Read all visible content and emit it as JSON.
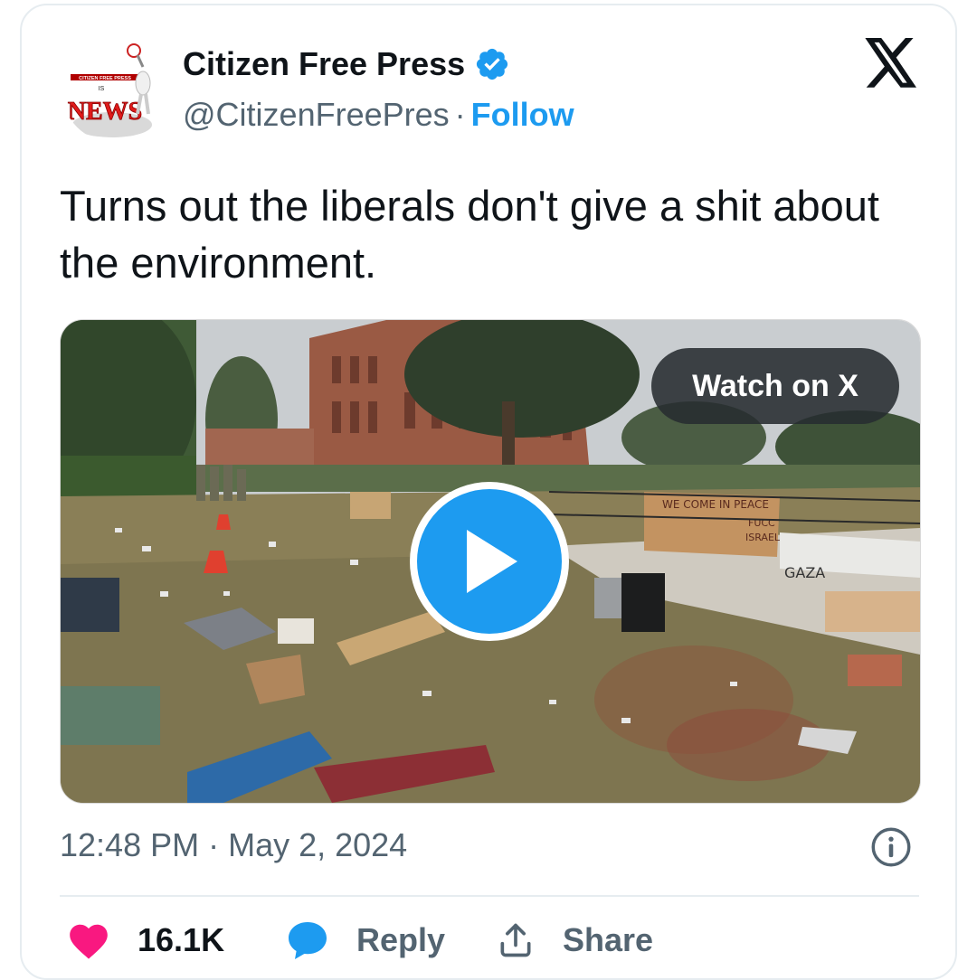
{
  "author": {
    "name": "Citizen Free Press",
    "handle": "@CitizenFreePres",
    "separator": "·",
    "follow_label": "Follow",
    "avatar_text": {
      "top": "CITIZEN FREE PRESS",
      "middle": "IS",
      "big": "NEWS"
    }
  },
  "tweet": {
    "text": "Turns out the liberals don't give a shit about the environment."
  },
  "media": {
    "watch_label": "Watch on X",
    "sign_text": [
      "WE COME IN PEACE",
      "FUCC",
      "ISRAEL",
      "GAZA"
    ]
  },
  "meta": {
    "timestamp": "12:48 PM · May 2, 2024"
  },
  "actions": {
    "like_count": "16.1K",
    "reply_label": "Reply",
    "share_label": "Share"
  },
  "colors": {
    "accent": "#1d9bf0",
    "like": "#f91880",
    "text": "#0f1419",
    "muted": "#536471"
  }
}
